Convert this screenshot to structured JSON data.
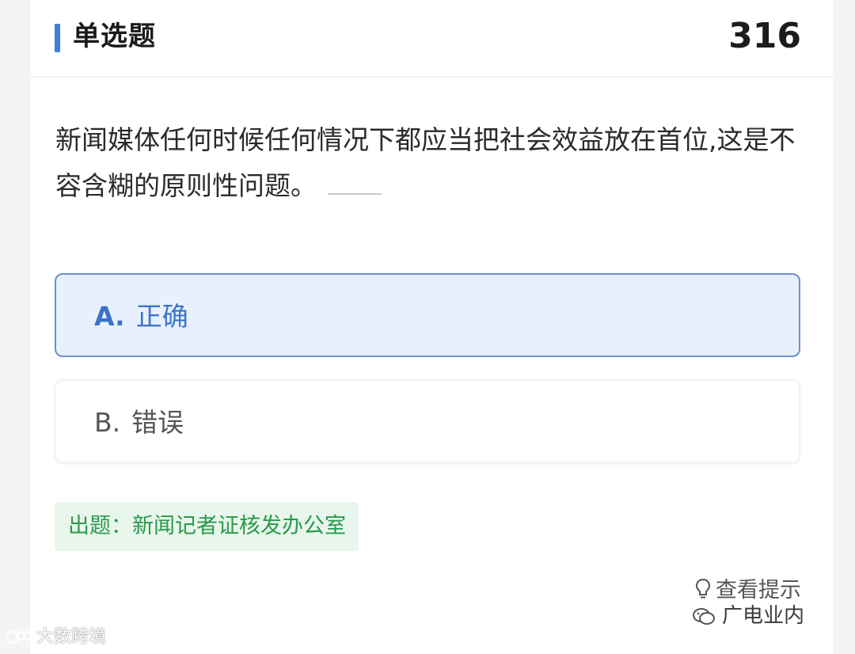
{
  "header": {
    "title": "单选题",
    "question_number": "316"
  },
  "question": {
    "text": "新闻媒体任何时候任何情况下都应当把社会效益放在首位,这是不容含糊的原则性问题。"
  },
  "options": [
    {
      "letter": "A.",
      "label": "正确",
      "selected": true
    },
    {
      "letter": "B.",
      "label": "错误",
      "selected": false
    }
  ],
  "source": {
    "text": "出题：新闻记者证核发办公室"
  },
  "hint": {
    "label": "查看提示",
    "icon": "lightbulb-icon"
  },
  "watermarks": {
    "left": "大数跨境",
    "right": "广电业内"
  },
  "colors": {
    "accent": "#3f7fe0",
    "selected_bg": "#e9f0fd",
    "selected_text": "#3a73c9",
    "source_bg": "#e8f6ec",
    "source_text": "#2a9a4a"
  }
}
